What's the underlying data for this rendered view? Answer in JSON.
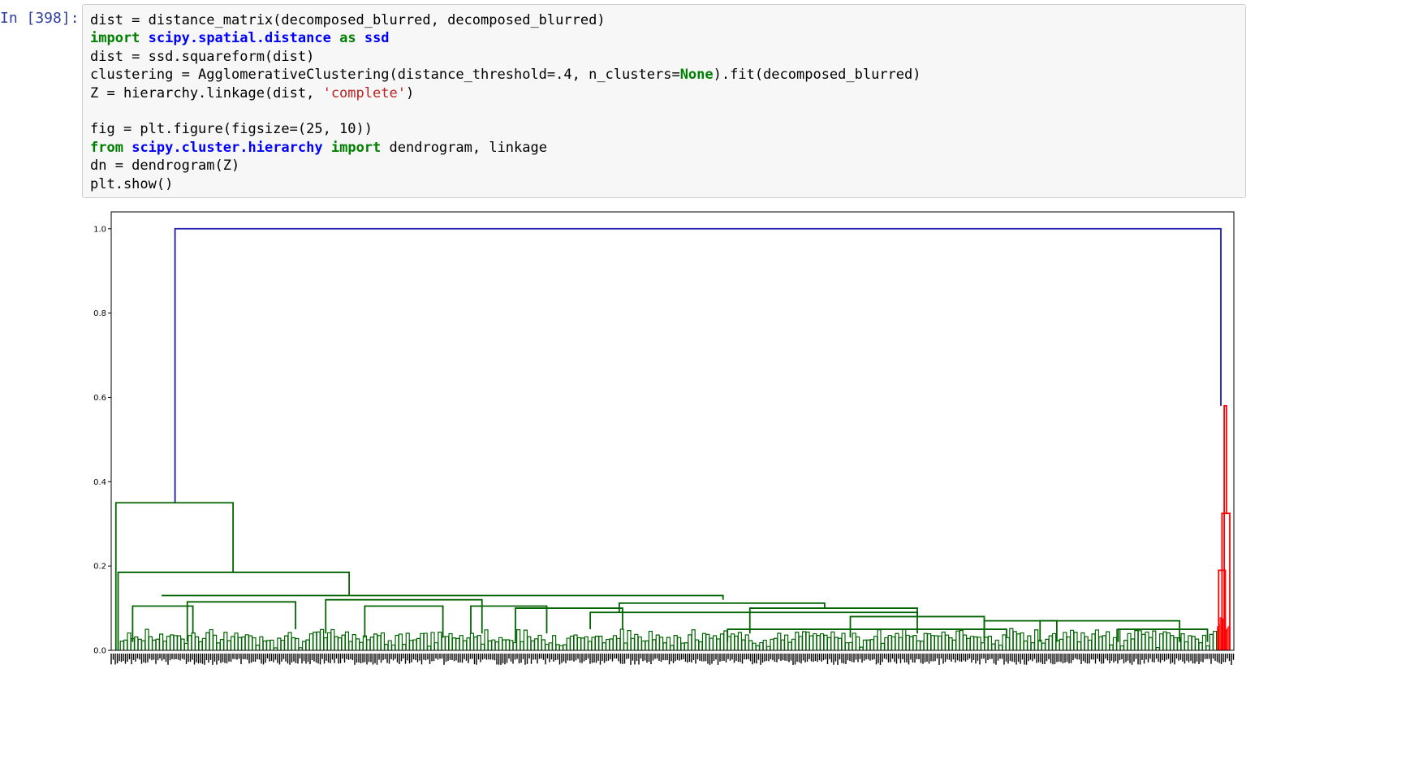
{
  "prompt": "In [398]:",
  "code_lines": [
    [
      {
        "t": "dist = distance_matrix(decomposed_blurred, decomposed_blurred)",
        "c": ""
      }
    ],
    [
      {
        "t": "import",
        "c": "kw"
      },
      {
        "t": " ",
        "c": ""
      },
      {
        "t": "scipy.spatial.distance",
        "c": "nn"
      },
      {
        "t": " ",
        "c": ""
      },
      {
        "t": "as",
        "c": "kw"
      },
      {
        "t": " ",
        "c": ""
      },
      {
        "t": "ssd",
        "c": "nn"
      }
    ],
    [
      {
        "t": "dist = ssd.squareform(dist)",
        "c": ""
      }
    ],
    [
      {
        "t": "clustering = AgglomerativeClustering(distance_threshold=.4, n_clusters=",
        "c": ""
      },
      {
        "t": "None",
        "c": "cn"
      },
      {
        "t": ").fit(decomposed_blurred)",
        "c": ""
      }
    ],
    [
      {
        "t": "Z = hierarchy.linkage(dist, ",
        "c": ""
      },
      {
        "t": "'complete'",
        "c": "str"
      },
      {
        "t": ")",
        "c": ""
      }
    ],
    [
      {
        "t": "",
        "c": ""
      }
    ],
    [
      {
        "t": "fig = plt.figure(figsize=(25, 10))",
        "c": ""
      }
    ],
    [
      {
        "t": "from",
        "c": "kw"
      },
      {
        "t": " ",
        "c": ""
      },
      {
        "t": "scipy.cluster.hierarchy",
        "c": "nn"
      },
      {
        "t": " ",
        "c": ""
      },
      {
        "t": "import",
        "c": "kw"
      },
      {
        "t": " dendrogram, linkage",
        "c": ""
      }
    ],
    [
      {
        "t": "dn = dendrogram(Z)",
        "c": ""
      }
    ],
    [
      {
        "t": "plt.show()",
        "c": ""
      }
    ]
  ],
  "chart_data": {
    "type": "dendrogram",
    "title": "",
    "xlabel": "",
    "ylabel": "",
    "ylim": [
      0,
      1.04
    ],
    "yticks": [
      "0.0",
      "0.2",
      "0.4",
      "0.6",
      "0.8",
      "1.0"
    ],
    "grid": false,
    "colors": {
      "root": "#1a1aa8",
      "cluster_1": "#006400",
      "cluster_2": "#ff0000",
      "labels": "#000000"
    },
    "root_merge_height": 1.0,
    "cluster_1_merge_height": 0.35,
    "cluster_2_merge_height": 0.58,
    "links": [
      {
        "color": "root",
        "x": [
          0.055,
          0.055,
          0.992,
          0.992
        ],
        "y": [
          0.35,
          1.0,
          1.0,
          0.58
        ]
      },
      {
        "color": "cluster_1",
        "x": [
          0.002,
          0.002,
          0.107,
          0.107
        ],
        "y": [
          0.0,
          0.35,
          0.35,
          0.185
        ]
      },
      {
        "color": "cluster_1",
        "x": [
          0.004,
          0.004,
          0.211,
          0.211
        ],
        "y": [
          0.0,
          0.185,
          0.185,
          0.13
        ]
      },
      {
        "color": "cluster_1",
        "x": [
          0.043,
          0.043,
          0.546,
          0.546
        ],
        "y": [
          0.13,
          0.13,
          0.13,
          0.12
        ]
      },
      {
        "color": "cluster_1",
        "x": [
          0.017,
          0.017,
          0.071,
          0.071
        ],
        "y": [
          0.02,
          0.105,
          0.105,
          0.04
        ]
      },
      {
        "color": "cluster_1",
        "x": [
          0.066,
          0.066,
          0.163,
          0.163
        ],
        "y": [
          0.02,
          0.115,
          0.115,
          0.05
        ]
      },
      {
        "color": "cluster_1",
        "x": [
          0.19,
          0.19,
          0.33,
          0.33
        ],
        "y": [
          0.04,
          0.12,
          0.12,
          0.04
        ]
      },
      {
        "color": "cluster_1",
        "x": [
          0.225,
          0.225,
          0.295,
          0.295
        ],
        "y": [
          0.03,
          0.105,
          0.105,
          0.03
        ]
      },
      {
        "color": "cluster_1",
        "x": [
          0.32,
          0.32,
          0.388,
          0.388
        ],
        "y": [
          0.04,
          0.105,
          0.105,
          0.04
        ]
      },
      {
        "color": "cluster_1",
        "x": [
          0.36,
          0.36,
          0.456,
          0.456
        ],
        "y": [
          0.02,
          0.1,
          0.1,
          0.05
        ]
      },
      {
        "color": "cluster_1",
        "x": [
          0.453,
          0.453,
          0.637,
          0.637
        ],
        "y": [
          0.09,
          0.112,
          0.112,
          0.1
        ]
      },
      {
        "color": "cluster_1",
        "x": [
          0.427,
          0.427,
          0.72,
          0.72
        ],
        "y": [
          0.05,
          0.09,
          0.09,
          0.08
        ]
      },
      {
        "color": "cluster_1",
        "x": [
          0.57,
          0.57,
          0.72,
          0.72
        ],
        "y": [
          0.04,
          0.1,
          0.1,
          0.04
        ]
      },
      {
        "color": "cluster_1",
        "x": [
          0.55,
          0.55,
          0.8,
          0.8
        ],
        "y": [
          0.02,
          0.05,
          0.05,
          0.03
        ]
      },
      {
        "color": "cluster_1",
        "x": [
          0.66,
          0.66,
          0.78,
          0.78
        ],
        "y": [
          0.03,
          0.08,
          0.08,
          0.03
        ]
      },
      {
        "color": "cluster_1",
        "x": [
          0.78,
          0.78,
          0.845,
          0.845
        ],
        "y": [
          0.02,
          0.07,
          0.07,
          0.02
        ]
      },
      {
        "color": "cluster_1",
        "x": [
          0.83,
          0.83,
          0.955,
          0.955
        ],
        "y": [
          0.02,
          0.07,
          0.07,
          0.02
        ]
      },
      {
        "color": "cluster_1",
        "x": [
          0.9,
          0.9,
          0.98,
          0.98
        ],
        "y": [
          0.02,
          0.05,
          0.05,
          0.02
        ]
      },
      {
        "color": "cluster_2",
        "x": [
          0.995,
          0.995,
          0.997,
          0.997
        ],
        "y": [
          0.0,
          0.58,
          0.58,
          0.325
        ]
      },
      {
        "color": "cluster_2",
        "x": [
          0.993,
          0.993,
          1.0,
          1.0
        ],
        "y": [
          0.0,
          0.325,
          0.325,
          0.0
        ]
      },
      {
        "color": "cluster_2",
        "x": [
          0.99,
          0.99,
          0.996,
          0.996
        ],
        "y": [
          0.0,
          0.19,
          0.19,
          0.0
        ]
      }
    ]
  }
}
